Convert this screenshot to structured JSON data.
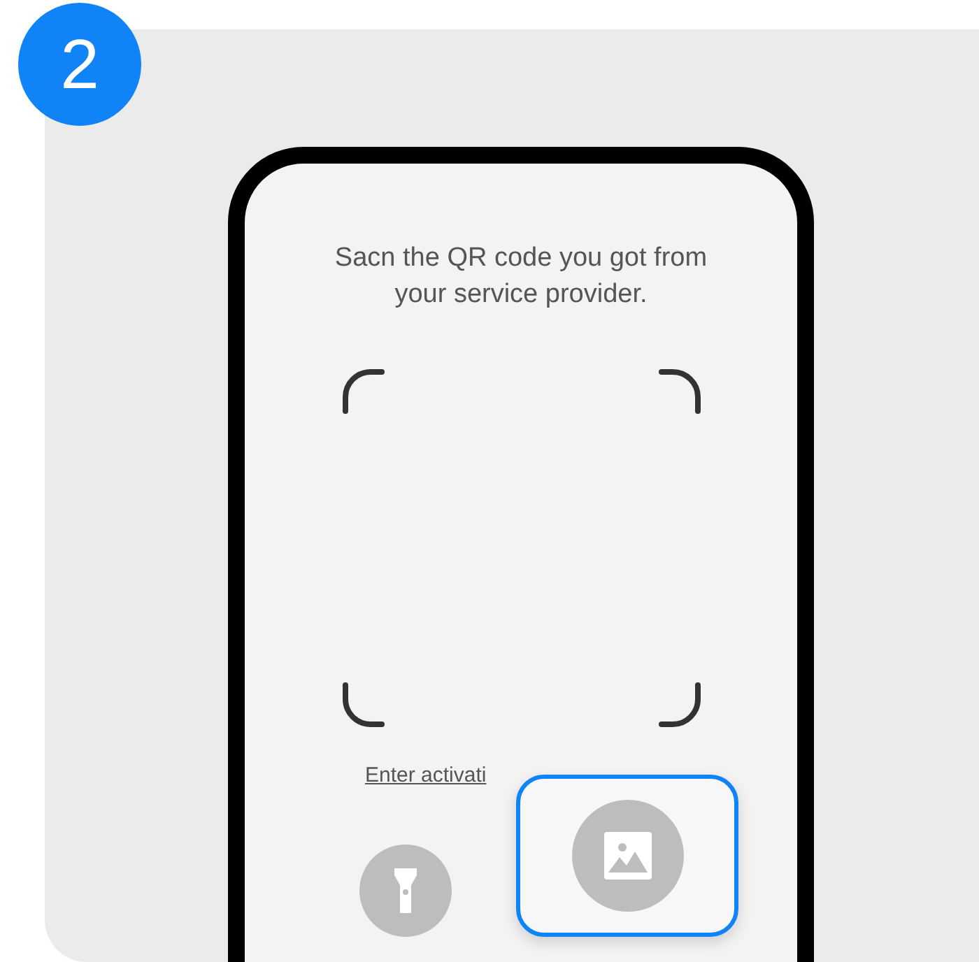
{
  "step_badge": "2",
  "phone": {
    "instruction": "Sacn the QR code you got from your service provider.",
    "link": "Enter activati",
    "buttons": [
      {
        "kind": "flashlight",
        "highlighted": false
      },
      {
        "kind": "gallery",
        "highlighted": true
      }
    ]
  }
}
